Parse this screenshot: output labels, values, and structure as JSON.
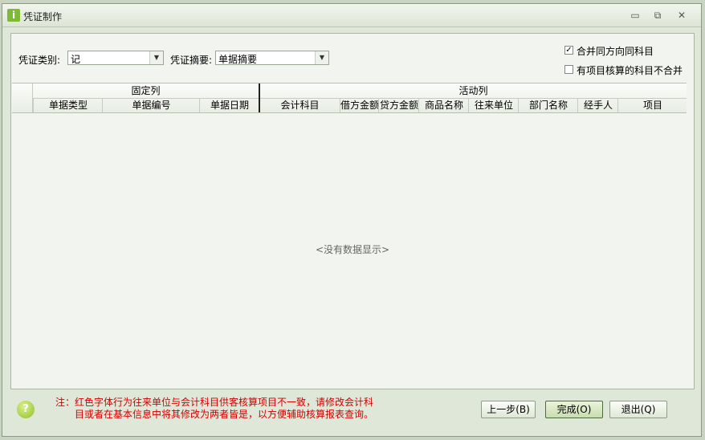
{
  "window": {
    "title": "凭证制作",
    "app_icon_glyph": "i",
    "controls": {
      "minimize": "▭",
      "restore": "⧉",
      "close": "✕"
    }
  },
  "filters": {
    "voucher_type_label": "凭证类别:",
    "voucher_type_value": "记",
    "summary_label": "凭证摘要:",
    "summary_value": "单据摘要",
    "dropdown_arrow": "▼"
  },
  "options": {
    "merge_same_direction": {
      "label": "合并同方向同科目",
      "checked": true
    },
    "no_merge_project": {
      "label": "有项目核算的科目不合并",
      "checked": false
    }
  },
  "grid": {
    "band_fixed": "固定列",
    "band_active": "活动列",
    "columns": [
      "单据类型",
      "单据编号",
      "单据日期",
      "会计科目",
      "借方金额",
      "贷方金额",
      "商品名称",
      "往来单位",
      "部门名称",
      "经手人",
      "项目"
    ],
    "empty_text": "<没有数据显示>"
  },
  "footer": {
    "note_line1": "注：红色字体行为往来单位与会计科目供客核算项目不一致，请修改会计科",
    "note_line2": "目或者在基本信息中将其修改为两者皆是，以方便辅助核算报表查询。",
    "buttons": {
      "prev": "上一步(B)",
      "finish": "完成(O)",
      "exit": "退出(Q)"
    }
  },
  "colors": {
    "note": "#d40000",
    "accent": "#7dbb35"
  }
}
